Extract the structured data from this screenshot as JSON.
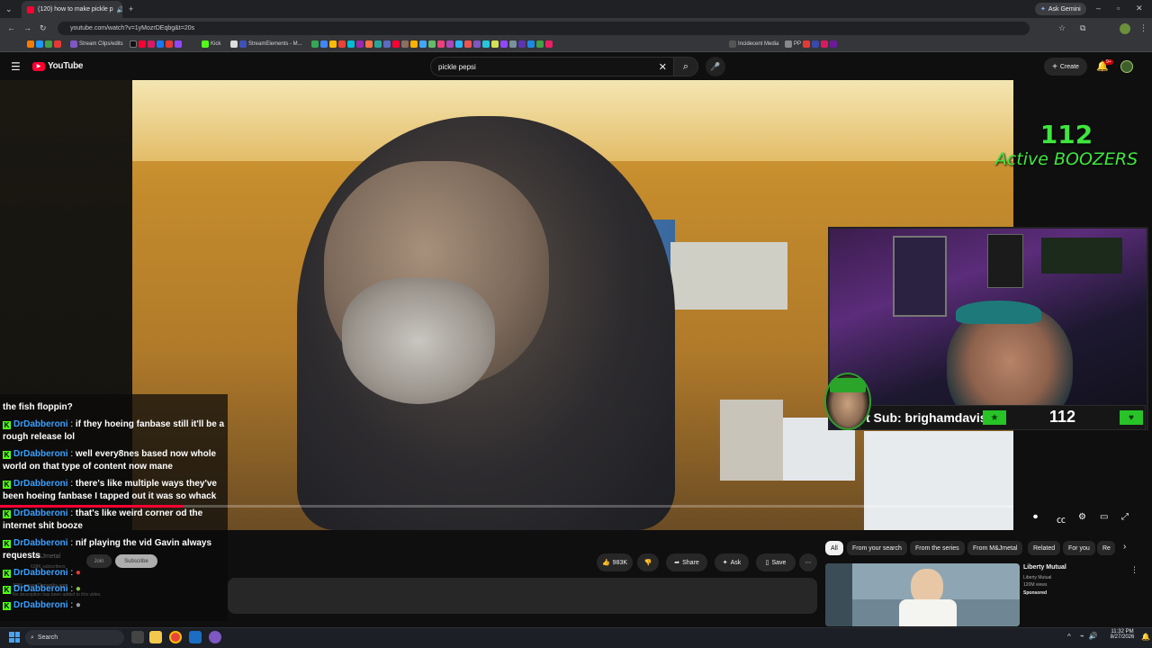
{
  "browser": {
    "tab_title": "(120) how to make pickle p",
    "url": "youtube.com/watch?v=1yMozrDEqbg&t=20s",
    "ask_gemini": "Ask Gemini",
    "bookmarks": [
      "Stream Clips/edits",
      "Kick",
      "StreamElements - M...",
      "Incidecent Media",
      "PP"
    ]
  },
  "youtube": {
    "logo_text": "YouTube",
    "search_value": "pickle pepsi",
    "create_label": "Create",
    "notifications_badge": "9+"
  },
  "video_overlay": {
    "counter_number": "112",
    "counter_label": "Active BOOZERS",
    "sub_text": "t Sub: brighamdavis",
    "sub_count": "112"
  },
  "chat": [
    {
      "user": "",
      "message": "the fish floppin?"
    },
    {
      "user": "DrDabberoni",
      "message": "if they hoeing fanbase still it'll be a rough release lol"
    },
    {
      "user": "DrDabberoni",
      "message": "well every8nes based now whole world on that type of content now mane"
    },
    {
      "user": "DrDabberoni",
      "message": "there's like multiple ways they've been hoeing fanbase I tapped out it was so whack"
    },
    {
      "user": "DrDabberoni",
      "message": "that's like weird corner od the internet shit booze"
    },
    {
      "user": "DrDabberoni",
      "message": "nif playing the vid Gavin always requests"
    },
    {
      "user": "DrDabberoni",
      "message": ""
    },
    {
      "user": "DrDabberoni",
      "message": ""
    },
    {
      "user": "DrDabberoni",
      "message": ""
    }
  ],
  "underlay": {
    "channel": "M&Jmetal",
    "subscribers": "628K subscribers",
    "join": "Join",
    "subscribe": "Subscribe",
    "views": "308K views 11 months ago",
    "description": "No description has been added to this video."
  },
  "actions": {
    "likes": "983K",
    "share": "Share",
    "ask": "Ask",
    "save": "Save"
  },
  "chips": [
    "All",
    "From your search",
    "From the series",
    "From M&Jmetal",
    "Related",
    "For you",
    "Re"
  ],
  "ad": {
    "title": "Liberty Mutual",
    "channel": "Liberty Mutual",
    "views": "120M views",
    "label": "Sponsored"
  },
  "taskbar": {
    "search": "Search",
    "time": "11:32 PM",
    "date": "8/27/2026"
  }
}
